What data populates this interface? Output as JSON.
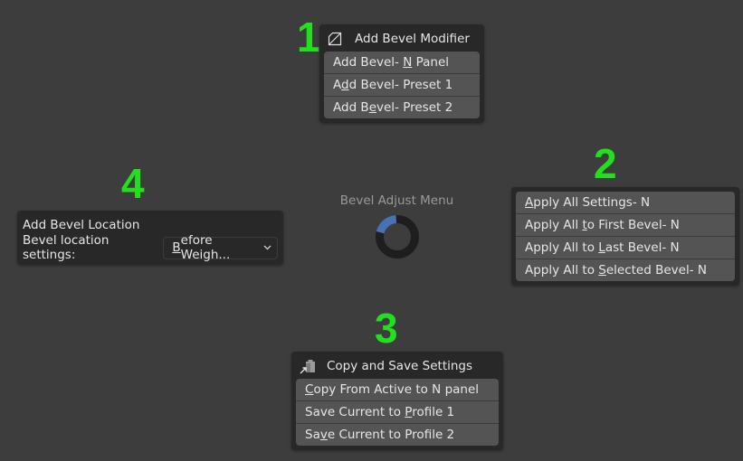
{
  "annotations": [
    "1",
    "2",
    "3",
    "4"
  ],
  "panel1": {
    "icon": "bevel-modifier-icon",
    "title": "Add Bevel Modifier",
    "items": [
      {
        "pre": "Add Bevel- ",
        "key": "N",
        "post": " Panel"
      },
      {
        "pre": "A",
        "key": "d",
        "post": "d Bevel- Preset 1"
      },
      {
        "pre": "Add B",
        "key": "e",
        "post": "vel- Preset 2"
      }
    ]
  },
  "panel2": {
    "items": [
      {
        "pre": "",
        "key": "A",
        "post": "pply All Settings- N"
      },
      {
        "pre": "Apply All ",
        "key": "t",
        "post": "o First Bevel- N"
      },
      {
        "pre": "Apply All to ",
        "key": "L",
        "post": "ast Bevel- N"
      },
      {
        "pre": "Apply All to ",
        "key": "S",
        "post": "elected Bevel- N"
      }
    ]
  },
  "panel3": {
    "icon": "copy-paste-icon",
    "title": "Copy and Save Settings",
    "items": [
      {
        "pre": "",
        "key": "C",
        "post": "opy From Active to N panel"
      },
      {
        "pre": "Save Current to ",
        "key": "P",
        "post": "rofile 1"
      },
      {
        "pre": "Sa",
        "key": "v",
        "post": "e Current to Profile 2"
      }
    ]
  },
  "panel4": {
    "title": "Add Bevel Location",
    "label": "Bevel location settings:",
    "dropdown": {
      "key": "B",
      "post": "efore Weigh...",
      "icon": "chevron-down-icon"
    }
  },
  "center": {
    "title": "Bevel Adjust Menu",
    "progress": 0.2,
    "accent": "#4772b3"
  }
}
